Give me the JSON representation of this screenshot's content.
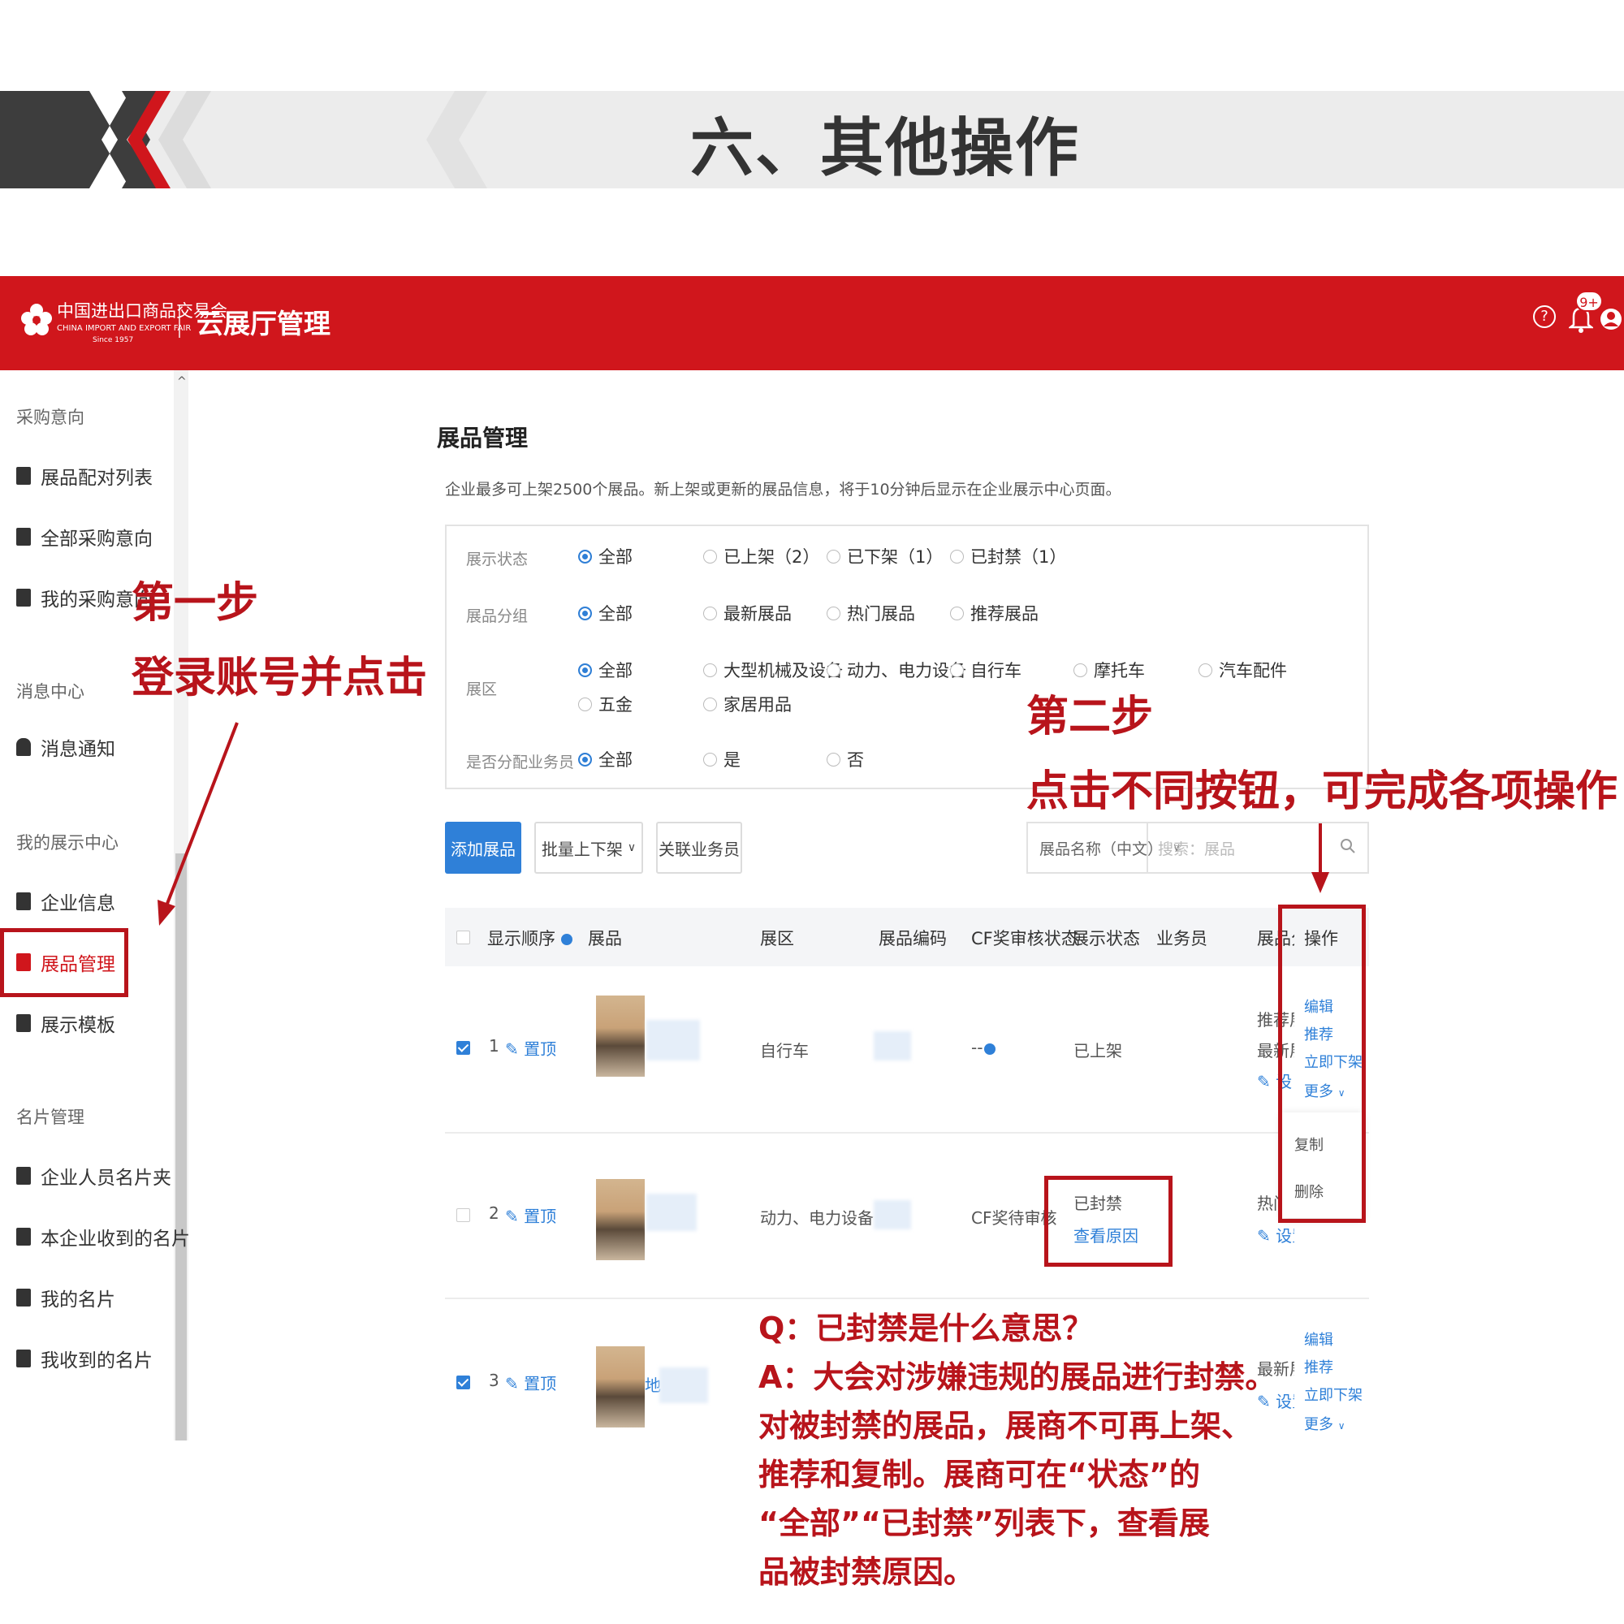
{
  "banner": {
    "title": "六、其他操作"
  },
  "app": {
    "logo_cn": "中国进出口商品交易会",
    "logo_en": "CHINA IMPORT AND EXPORT FAIR",
    "logo_since": "Since 1957",
    "name": "云展厅管理",
    "notification_badge": "9+",
    "brand_color": "#d0161c"
  },
  "sidebar": {
    "groups": [
      {
        "title": "采购意向",
        "items": [
          "展品配对列表",
          "全部采购意向",
          "我的采购意向"
        ]
      },
      {
        "title": "消息中心",
        "items": [
          "消息通知"
        ]
      },
      {
        "title": "我的展示中心",
        "items": [
          "企业信息",
          "展品管理",
          "展示模板"
        ]
      },
      {
        "title": "名片管理",
        "items": [
          "企业人员名片夹",
          "本企业收到的名片",
          "我的名片",
          "我收到的名片"
        ]
      }
    ],
    "active_item": "展品管理"
  },
  "main": {
    "title": "展品管理",
    "description": "企业最多可上架2500个展品。新上架或更新的展品信息，将于10分钟后显示在企业展示中心页面。",
    "filters": {
      "status": {
        "label": "展示状态",
        "options": [
          "全部",
          "已上架（2）",
          "已下架（1）",
          "已封禁（1）"
        ],
        "selected": "全部"
      },
      "group": {
        "label": "展品分组",
        "options": [
          "全部",
          "最新展品",
          "热门展品",
          "推荐展品"
        ],
        "selected": "全部"
      },
      "zone": {
        "label": "展区",
        "options": [
          "全部",
          "大型机械及设备",
          "动力、电力设备",
          "自行车",
          "摩托车",
          "汽车配件",
          "五金",
          "家居用品"
        ],
        "selected": "全部"
      },
      "assigned": {
        "label": "是否分配业务员",
        "options": [
          "全部",
          "是",
          "否"
        ],
        "selected": "全部"
      }
    },
    "toolbar": {
      "add": "添加展品",
      "batch": "批量上下架",
      "link_staff": "关联业务员",
      "search_field": "展品名称（中文）",
      "search_placeholder": "搜索：展品"
    },
    "table": {
      "columns": [
        "显示顺序",
        "展品",
        "展区",
        "展品编码",
        "CF奖审核状态",
        "展示状态",
        "业务员",
        "展品分",
        "操作"
      ],
      "rows": [
        {
          "checked": true,
          "order": "1",
          "pin": "置顶",
          "zone": "自行车",
          "cf_status": "--",
          "status": "已上架",
          "group": [
            "推荐展",
            "最新展"
          ],
          "set": "设",
          "actions": [
            "编辑",
            "推荐",
            "立即下架",
            "更多"
          ]
        },
        {
          "checked": false,
          "order": "2",
          "pin": "置顶",
          "zone": "动力、电力设备",
          "cf_status": "CF奖待审核",
          "status": "已封禁",
          "status_link": "查看原因",
          "group": [
            "热门"
          ],
          "set": "设置",
          "actions": []
        },
        {
          "checked": true,
          "order": "3",
          "pin": "置顶",
          "zone": "",
          "cf_status": "",
          "status": "",
          "group": [
            "最新展"
          ],
          "set": "设置",
          "actions": [
            "编辑",
            "推荐",
            "立即下架",
            "更多"
          ],
          "thumb_label": "地"
        }
      ],
      "more_menu": [
        "复制",
        "删除"
      ]
    }
  },
  "annotations": {
    "step1_title": "第一步",
    "step1_text": "登录账号并点击",
    "step2_title": "第二步",
    "step2_text": "点击不同按钮，可完成各项操作",
    "qa": [
      "Q：已封禁是什么意思？",
      "A：大会对涉嫌违规的展品进行封禁。",
      "对被封禁的展品，展商不可再上架、",
      "推荐和复制。展商可在“状态”的",
      "“全部”“已封禁”列表下，查看展",
      "品被封禁原因。"
    ],
    "annotation_color": "#b8141b"
  }
}
